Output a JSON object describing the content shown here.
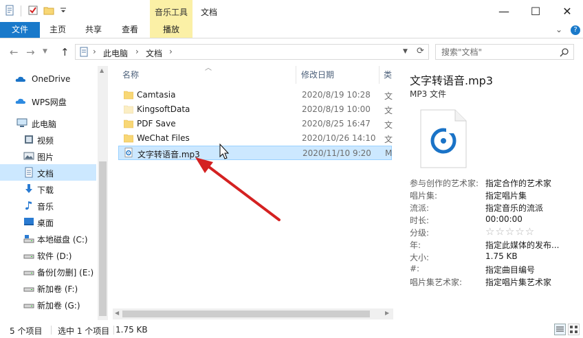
{
  "titlebar": {
    "context_group": "音乐工具",
    "window_title": "文档",
    "minimize": "—",
    "maximize": "☐",
    "close": "✕"
  },
  "ribbon": {
    "tabs": [
      "文件",
      "主页",
      "共享",
      "查看",
      "播放"
    ],
    "expand": "⌄",
    "help": "?"
  },
  "address": {
    "segments": [
      "此电脑",
      "文档"
    ],
    "search_placeholder": "搜索\"文档\""
  },
  "nav_pane": {
    "items": [
      {
        "label": "OneDrive",
        "icon": "cloud-icon"
      },
      {
        "label": "WPS网盘",
        "icon": "cloud-icon"
      },
      {
        "label": "此电脑",
        "icon": "computer-icon"
      },
      {
        "label": "视频",
        "icon": "video-icon"
      },
      {
        "label": "图片",
        "icon": "picture-icon"
      },
      {
        "label": "文档",
        "icon": "document-icon",
        "selected": true
      },
      {
        "label": "下载",
        "icon": "download-icon"
      },
      {
        "label": "音乐",
        "icon": "music-icon"
      },
      {
        "label": "桌面",
        "icon": "desktop-icon"
      },
      {
        "label": "本地磁盘 (C:)",
        "icon": "drive-icon"
      },
      {
        "label": "软件 (D:)",
        "icon": "drive-icon"
      },
      {
        "label": "备份[勿删] (E:)",
        "icon": "drive-icon"
      },
      {
        "label": "新加卷 (F:)",
        "icon": "drive-icon"
      },
      {
        "label": "新加卷 (G:)",
        "icon": "drive-icon"
      }
    ]
  },
  "file_list": {
    "columns": [
      "名称",
      "修改日期",
      "类"
    ],
    "rows": [
      {
        "name": "Camtasia",
        "date": "2020/8/19 10:28",
        "type": "文",
        "icon": "folder-icon"
      },
      {
        "name": "KingsoftData",
        "date": "2020/8/19 10:00",
        "type": "文",
        "icon": "folder-icon-empty"
      },
      {
        "name": "PDF Save",
        "date": "2020/8/25 16:47",
        "type": "文",
        "icon": "folder-icon"
      },
      {
        "name": "WeChat Files",
        "date": "2020/10/26 14:10",
        "type": "文",
        "icon": "folder-icon"
      },
      {
        "name": "文字转语音.mp3",
        "date": "2020/11/10 9:20",
        "type": "M",
        "icon": "mp3-file-icon",
        "selected": true
      }
    ]
  },
  "details": {
    "title": "文字转语音.mp3",
    "subtitle": "MP3 文件",
    "properties": [
      {
        "key": "参与创作的艺术家:",
        "value": "指定合作的艺术家"
      },
      {
        "key": "唱片集:",
        "value": "指定唱片集"
      },
      {
        "key": "流派:",
        "value": "指定音乐的流派"
      },
      {
        "key": "时长:",
        "value": "00:00:00"
      },
      {
        "key": "分级:",
        "value": "☆☆☆☆☆",
        "rating": 0
      },
      {
        "key": "年:",
        "value": "指定此媒体的发布..."
      },
      {
        "key": "大小:",
        "value": "1.75 KB"
      },
      {
        "key": "#:",
        "value": "指定曲目编号"
      },
      {
        "key": "唱片集艺术家:",
        "value": "指定唱片集艺术家"
      }
    ]
  },
  "status": {
    "count": "5 个项目",
    "selected": "选中 1 个项目",
    "size": "1.75 KB"
  },
  "colors": {
    "accent": "#1979ca",
    "context_tab": "#fbf0a6",
    "selection": "#cce8ff",
    "folder": "#f8d775",
    "arrow": "#d42121"
  }
}
